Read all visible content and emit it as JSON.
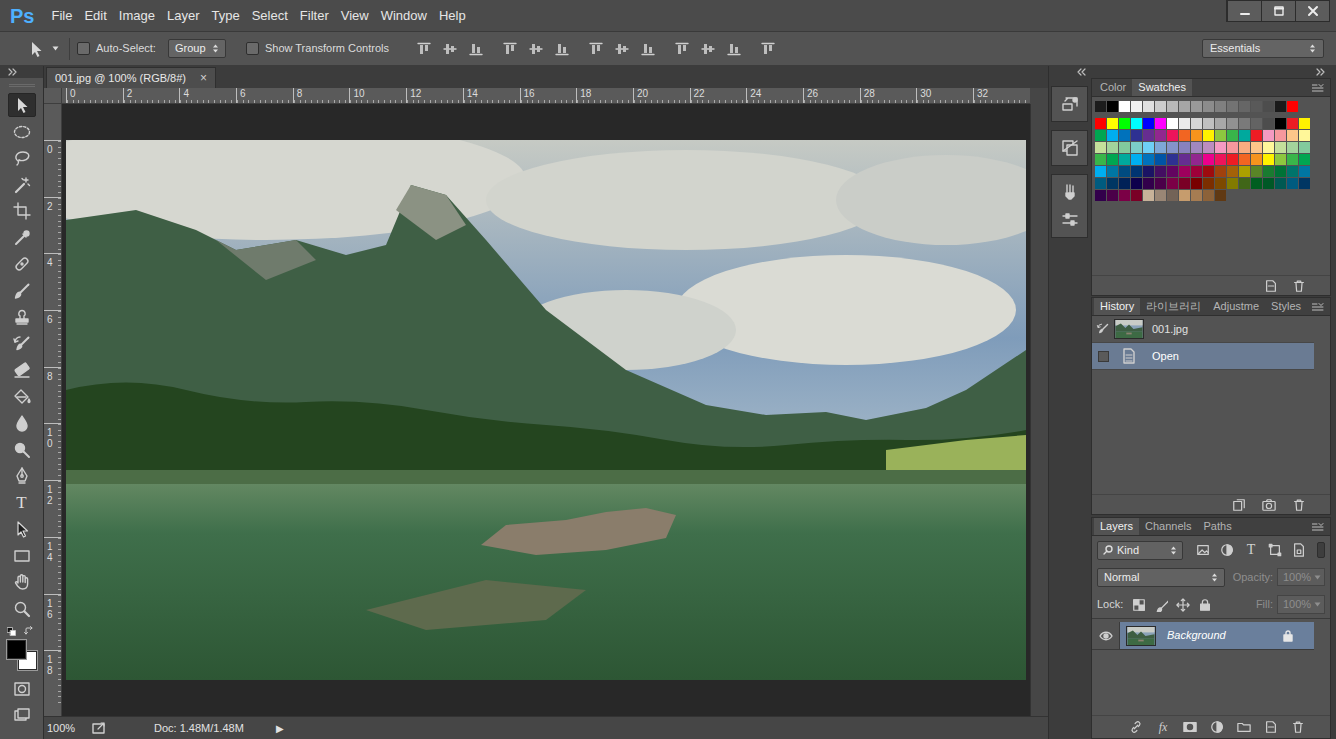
{
  "app": {
    "logo": "Ps"
  },
  "menu": [
    "File",
    "Edit",
    "Image",
    "Layer",
    "Type",
    "Select",
    "Filter",
    "View",
    "Window",
    "Help"
  ],
  "window_controls": [
    {
      "kind": "minimize"
    },
    {
      "kind": "restore"
    },
    {
      "kind": "close"
    }
  ],
  "options_bar": {
    "auto_select": {
      "label": "Auto-Select:",
      "checked": false
    },
    "auto_select_target": "Group",
    "transform_controls": {
      "label": "Show Transform Controls",
      "checked": false
    },
    "workspace": "Essentials"
  },
  "tools": [
    {
      "kind": "move",
      "selected": true
    },
    {
      "kind": "marquee",
      "selected": false
    },
    {
      "kind": "lasso",
      "selected": false
    },
    {
      "kind": "wand",
      "selected": false
    },
    {
      "kind": "crop",
      "selected": false
    },
    {
      "kind": "eyedropper",
      "selected": false
    },
    {
      "kind": "healing",
      "selected": false
    },
    {
      "kind": "brush",
      "selected": false
    },
    {
      "kind": "stamp",
      "selected": false
    },
    {
      "kind": "history",
      "selected": false
    },
    {
      "kind": "eraser",
      "selected": false
    },
    {
      "kind": "bucket",
      "selected": false
    },
    {
      "kind": "blur",
      "selected": false
    },
    {
      "kind": "dodge",
      "selected": false
    },
    {
      "kind": "pen",
      "selected": false
    },
    {
      "kind": "type",
      "glyph": "T",
      "selected": false
    },
    {
      "kind": "path",
      "selected": false
    },
    {
      "kind": "shape",
      "selected": false
    },
    {
      "kind": "hand",
      "selected": false
    },
    {
      "kind": "zoom",
      "selected": false
    }
  ],
  "colors": {
    "foreground": "#000000",
    "background": "#ffffff"
  },
  "document": {
    "tab": "001.jpg @ 100% (RGB/8#)",
    "close": "×",
    "ruler": {
      "horizontal": [
        "0",
        "2",
        "4",
        "6",
        "8",
        "10",
        "12",
        "14",
        "16",
        "18",
        "20",
        "22",
        "24",
        "26",
        "28",
        "30",
        "32"
      ],
      "vertical": [
        "0",
        "2",
        "4",
        "6",
        "8",
        "10",
        "12",
        "14",
        "16",
        "18"
      ]
    }
  },
  "status_bar": {
    "zoom": "100%",
    "doc": "Doc: 1.48M/1.48M",
    "arrow": "▶"
  },
  "swatches_panel": {
    "tabs": [
      {
        "label": "Color",
        "selected": false
      },
      {
        "label": "Swatches",
        "selected": true
      }
    ],
    "rows": [
      [
        "#1c1c1c",
        "#000000",
        "#ffffff",
        "#f2f2f2",
        "#e0e0e0",
        "#cccccc",
        "#b8b8b8",
        "#a6a6a6",
        "#999999",
        "#8c8c8c",
        "#808080",
        "#737373",
        "#666666",
        "#595959",
        "#4d4d4d",
        "#1a1a1a",
        "#ff0000"
      ],
      [
        "#ff0000",
        "#ffff00",
        "#00ff00",
        "#00ffff",
        "#0000ff",
        "#ff00ff",
        "#ffffff",
        "#ebebeb",
        "#d6d6d6",
        "#c0c0c0",
        "#a8a8a8",
        "#919191",
        "#7a7a7a",
        "#636363",
        "#4d4d4d",
        "#000000",
        "#ed1c24",
        "#fff200"
      ],
      [
        "#00a651",
        "#00aeef",
        "#0072bc",
        "#2e3192",
        "#662d91",
        "#92278f",
        "#ed145b",
        "#f26522",
        "#f7941d",
        "#fff200",
        "#8dc73f",
        "#39b54a",
        "#00a99d",
        "#ed1c24",
        "#f49ac2",
        "#f6989d",
        "#fdc68a",
        "#fff799"
      ],
      [
        "#c4df9b",
        "#a3d39c",
        "#82ca9d",
        "#7bcdc8",
        "#6ecff6",
        "#7ea7d8",
        "#8493ca",
        "#8882be",
        "#a187be",
        "#bc8dbf",
        "#f49ac2",
        "#f6989d",
        "#f9ad81",
        "#fdc68a",
        "#fff79a",
        "#c4df9b",
        "#a3d39c",
        "#82ca9d"
      ],
      [
        "#39b54a",
        "#00a651",
        "#00a99d",
        "#00aeef",
        "#0072bc",
        "#0054a6",
        "#2e3192",
        "#662d91",
        "#92278f",
        "#ec008c",
        "#ed145b",
        "#ed1c24",
        "#f26522",
        "#f7941d",
        "#fff200",
        "#8dc73f",
        "#39b54a",
        "#00a651"
      ],
      [
        "#00aeef",
        "#0076a3",
        "#004b80",
        "#003471",
        "#1b1464",
        "#440e62",
        "#630460",
        "#9e005d",
        "#9e0039",
        "#9e0b0f",
        "#a0410d",
        "#a36209",
        "#aba000",
        "#598527",
        "#197b30",
        "#007236",
        "#00746b",
        "#0076a3"
      ],
      [
        "#005b7f",
        "#003663",
        "#002157",
        "#0d004c",
        "#32004b",
        "#4b0049",
        "#7b0046",
        "#7a0026",
        "#790000",
        "#7b2e00",
        "#7d4900",
        "#827b00",
        "#406618",
        "#005e20",
        "#005826",
        "#005952",
        "#005b7f",
        "#003663"
      ],
      [
        "#32004b",
        "#4b0049",
        "#7b0046",
        "#7a0026",
        "#c7b299",
        "#998675",
        "#736357",
        "#c69c6d",
        "#a67c52",
        "#8c6239",
        "#603913"
      ]
    ]
  },
  "history_panel": {
    "tabs": [
      {
        "label": "History",
        "selected": true
      },
      {
        "label": "라이브러리",
        "selected": false
      },
      {
        "label": "Adjustme",
        "selected": false
      },
      {
        "label": "Styles",
        "selected": false
      }
    ],
    "items": [
      {
        "label": "001.jpg",
        "kind": "snapshot",
        "selected": false
      },
      {
        "label": "Open",
        "kind": "step",
        "selected": true
      }
    ]
  },
  "layers_panel": {
    "tabs": [
      {
        "label": "Layers",
        "selected": true
      },
      {
        "label": "Channels",
        "selected": false
      },
      {
        "label": "Paths",
        "selected": false
      }
    ],
    "filter": "Kind",
    "filter_type_glyph": "T",
    "blend_mode": "Normal",
    "opacity_label": "Opacity:",
    "opacity": "100%",
    "opacity_disabled": true,
    "lock_label": "Lock:",
    "fill_label": "Fill:",
    "fill": "100%",
    "fill_disabled": true,
    "layers": [
      {
        "name": "Background",
        "visible": true,
        "locked": true,
        "selected": true
      }
    ],
    "footer_fx": "fx"
  }
}
